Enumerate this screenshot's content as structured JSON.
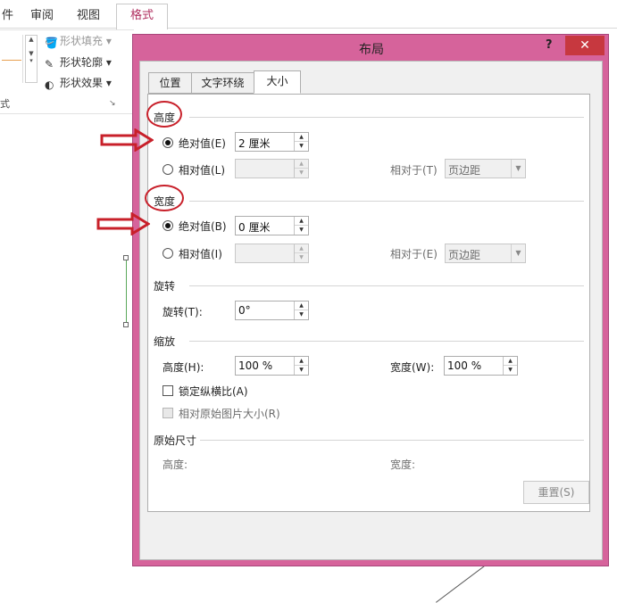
{
  "ribbon": {
    "tabs": [
      "件",
      "审阅",
      "视图"
    ],
    "active_tab": "格式",
    "shape_fill": "形状填充",
    "shape_outline": "形状轮廓",
    "shape_effects": "形状效果",
    "group_caption": "式"
  },
  "dialog": {
    "title": "布局",
    "help": "?",
    "close": "✕",
    "tabs": [
      "位置",
      "文字环绕",
      "大小"
    ],
    "active_tab_index": 2,
    "height": {
      "section": "高度",
      "absolute_label": "绝对值(E)",
      "absolute_value": "2 厘米",
      "relative_label": "相对值(L)",
      "relative_to_label": "相对于(T)",
      "relative_to_value": "页边距"
    },
    "width": {
      "section": "宽度",
      "absolute_label": "绝对值(B)",
      "absolute_value": "0 厘米",
      "relative_label": "相对值(I)",
      "relative_to_label": "相对于(E)",
      "relative_to_value": "页边距"
    },
    "rotate": {
      "section": "旋转",
      "label": "旋转(T):",
      "value": "0°"
    },
    "scale": {
      "section": "缩放",
      "height_label": "高度(H):",
      "height_value": "100 %",
      "width_label": "宽度(W):",
      "width_value": "100 %",
      "lock_aspect": "锁定纵横比(A)",
      "relative_original": "相对原始图片大小(R)"
    },
    "original": {
      "section": "原始尺寸",
      "height_label": "高度:",
      "width_label": "宽度:"
    },
    "reset_button": "重置(S)"
  },
  "colors": {
    "dialog_frame": "#d6639b",
    "annotation_red": "#c8202a",
    "close_button": "#c7383f"
  }
}
